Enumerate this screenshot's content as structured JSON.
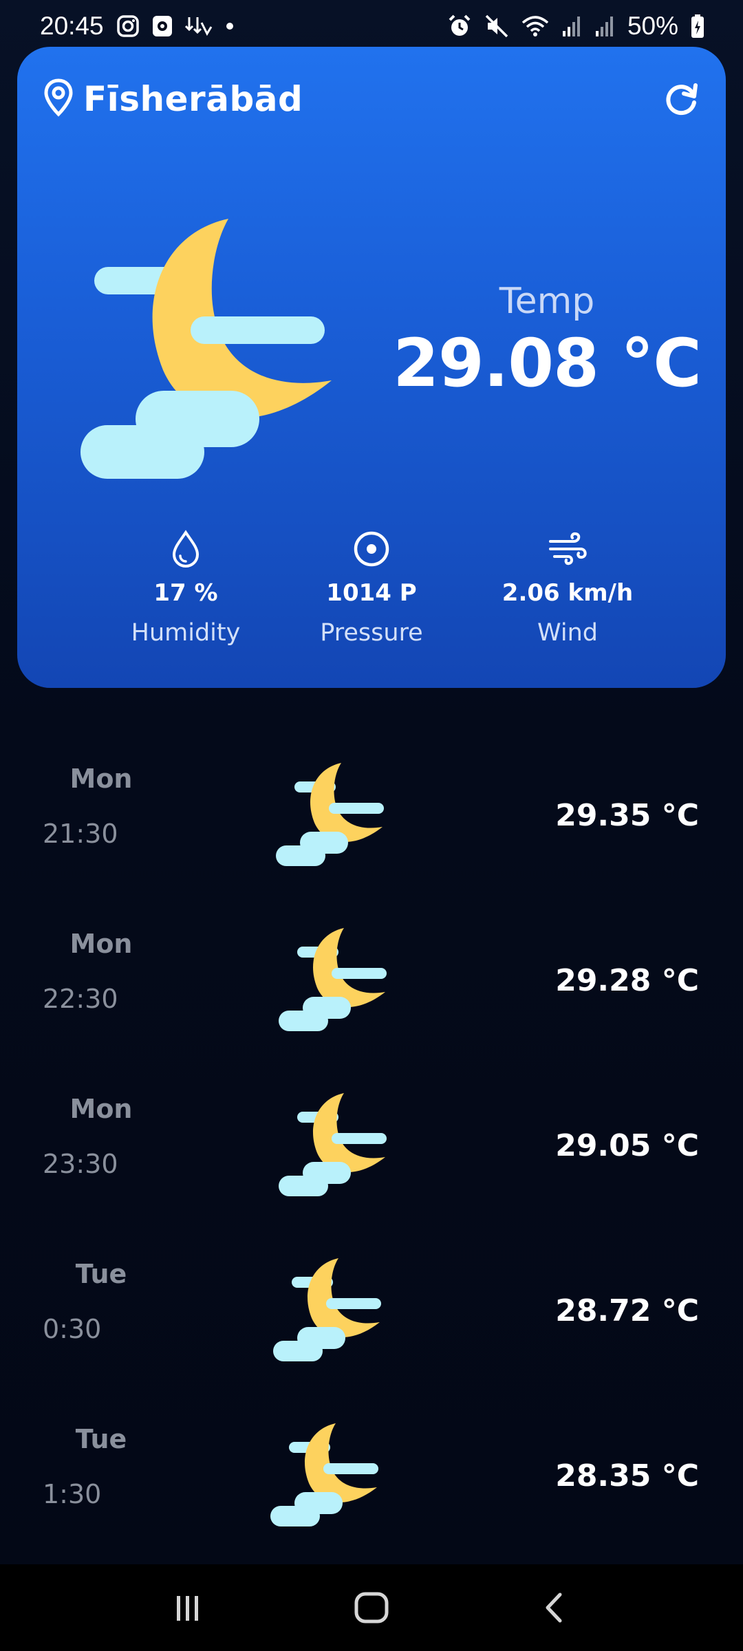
{
  "status_bar": {
    "time": "20:45",
    "left_icons": [
      "instagram-icon",
      "app-icon",
      "download-icon",
      "dot-icon"
    ],
    "right_icons": [
      "alarm-icon",
      "mute-icon",
      "wifi-icon",
      "signal-icon",
      "signal-icon-2"
    ],
    "battery": "50%"
  },
  "card": {
    "location_icon": "location-pin-icon",
    "city": "Fīsherābād",
    "refresh_icon": "refresh-icon",
    "condition_icon": "moon-cloud-icon",
    "temp_label": "Temp",
    "temp_value": "29.08 °C",
    "metrics": [
      {
        "icon": "drop-icon",
        "value": "17 %",
        "label": "Humidity"
      },
      {
        "icon": "pressure-icon",
        "value": "1014 P",
        "label": "Pressure"
      },
      {
        "icon": "wind-icon",
        "value": "2.06 km/h",
        "label": "Wind"
      }
    ]
  },
  "forecast": [
    {
      "day": "Mon",
      "time": "21:30",
      "icon": "moon-cloud-icon",
      "temp": "29.35 °C"
    },
    {
      "day": "Mon",
      "time": "22:30",
      "icon": "moon-cloud-icon",
      "temp": "29.28 °C"
    },
    {
      "day": "Mon",
      "time": "23:30",
      "icon": "moon-cloud-icon",
      "temp": "29.05 °C"
    },
    {
      "day": "Tue",
      "time": "0:30",
      "icon": "moon-cloud-icon",
      "temp": "28.72 °C"
    },
    {
      "day": "Tue",
      "time": "1:30",
      "icon": "moon-cloud-icon",
      "temp": "28.35 °C"
    }
  ],
  "nav": [
    "recent-apps-icon",
    "home-icon",
    "back-icon"
  ],
  "colors": {
    "card_top": "#2172ee",
    "card_bottom": "#1346b4",
    "moon": "#fdd25e",
    "cloud": "#b9f1fb",
    "background": "#050b1c"
  }
}
